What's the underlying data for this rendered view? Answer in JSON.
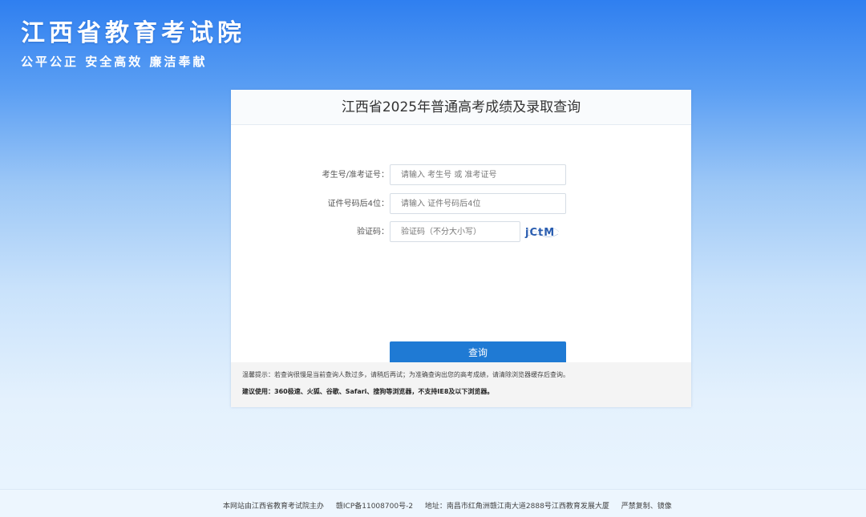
{
  "header": {
    "title": "江西省教育考试院",
    "slogan": "公平公正 安全高效 廉洁奉献"
  },
  "card": {
    "title": "江西省2025年普通高考成绩及录取查询",
    "form": {
      "exam_id_label": "考生号/准考证号：",
      "exam_id_placeholder": "请输入 考生号 或 准考证号",
      "id_last4_label": "证件号码后4位：",
      "id_last4_placeholder": "请输入 证件号码后4位",
      "captcha_label": "验证码：",
      "captcha_placeholder": "验证码（不分大小写）",
      "captcha_text": "jCtM",
      "submit_label": "查询"
    },
    "notice": {
      "line1": "温馨提示：若查询很慢是当前查询人数过多，请稍后再试；为准确查询出您的高考成绩，请清除浏览器缓存后查询。",
      "line2": "建议使用：360极速、火狐、谷歌、Safari、搜狗等浏览器，不支持IE8及以下浏览器。"
    }
  },
  "footer": {
    "host": "本网站由江西省教育考试院主办",
    "icp": "赣ICP备11008700号-2",
    "address": "地址：南昌市红角洲赣江南大道2888号江西教育发展大厦",
    "copyright": "严禁复制、镜像"
  },
  "colors": {
    "accent": "#1f7ad4",
    "background_top": "#2f7ff0",
    "background_bottom": "#eaf5fe"
  }
}
